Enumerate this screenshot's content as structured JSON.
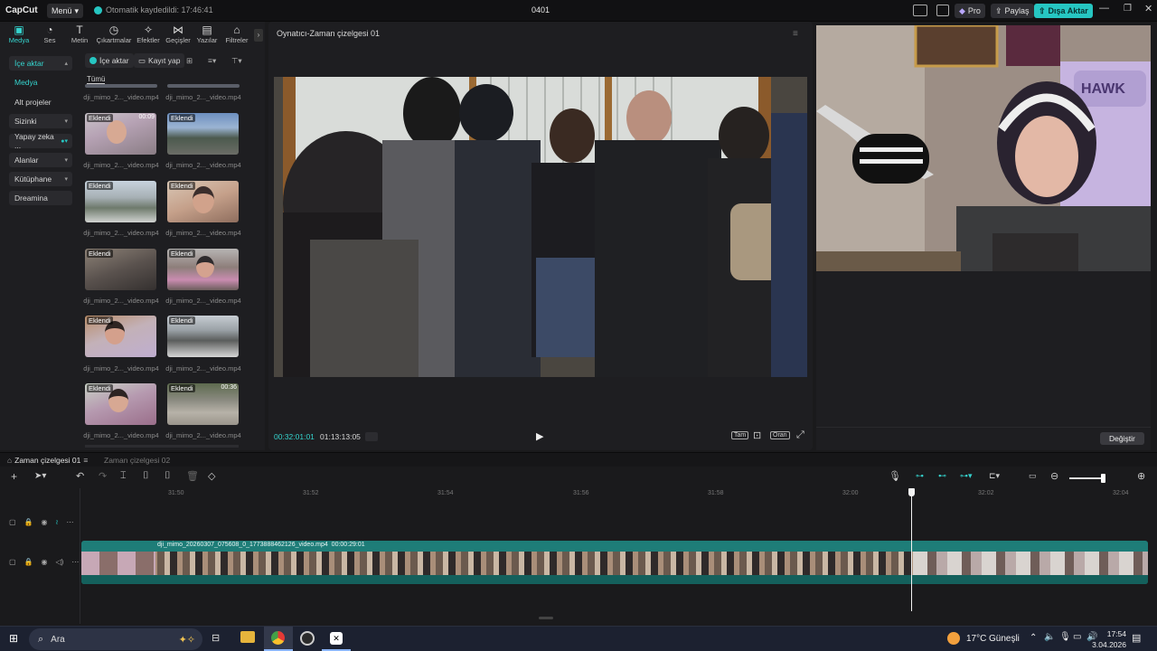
{
  "titlebar": {
    "logo": "CapCut",
    "menu": "Menü",
    "autosave": "Otomatik kaydedildi: 17:46:41",
    "project": "0401",
    "pro": "Pro",
    "share": "Paylaş",
    "export": "Dışa Aktar"
  },
  "tool_tabs": [
    "Medya",
    "Ses",
    "Metin",
    "Çıkartmalar",
    "Efektler",
    "Geçişler",
    "Yazılar",
    "Filtreler"
  ],
  "left_nav": [
    "İçe aktar",
    "Medya",
    "Alt projeler",
    "Sizinki",
    "Yapay zeka ...",
    "Alanlar",
    "Kütüphane",
    "Dreamina"
  ],
  "media_bar": {
    "import": "İçe aktar",
    "record": "Kayıt yap",
    "all": "Tümü"
  },
  "media_items": [
    {
      "label": "Eklendi",
      "duration": "00:09",
      "name": "dji_mimo_2..._video.mp4"
    },
    {
      "label": "Eklendi",
      "duration": "",
      "name": "dji_mimo_2..._video.mp4"
    },
    {
      "label": "Eklendi",
      "duration": "",
      "name": "dji_mimo_2..._video.mp4"
    },
    {
      "label": "Eklendi",
      "duration": "",
      "name": "dji_mimo_2..._video.mp4"
    },
    {
      "label": "Eklendi",
      "duration": "",
      "name": "dji_mimo_2..._video.mp4"
    },
    {
      "label": "Eklendi",
      "duration": "",
      "name": "dji_mimo_2..._video.mp4"
    },
    {
      "label": "Eklendi",
      "duration": "",
      "name": "dji_mimo_2..._video.mp4"
    },
    {
      "label": "Eklendi",
      "duration": "",
      "name": "dji_mimo_2..._video.mp4"
    },
    {
      "label": "Eklendi",
      "duration": "",
      "name": "dji_mimo_2..._video.mp4"
    },
    {
      "label": "Eklendi",
      "duration": "00:36",
      "name": "dji_mimo_2..._video.mp4"
    }
  ],
  "media_top_names": [
    "dji_mimo_2..._video.mp4",
    "dji_mimo_2..._video.mp4"
  ],
  "player": {
    "title": "Oynatıcı-Zaman çizelgesi 01",
    "current": "00:32:01:01",
    "total": "01:13:13:05",
    "full_label": "Tam",
    "ratio_label": "Oran"
  },
  "right_panel": {
    "change": "Değiştir"
  },
  "timeline": {
    "tab1": "Zaman çizelgesi 01",
    "tab2": "Zaman çizelgesi 02",
    "ticks": [
      "31:50",
      "31:52",
      "31:54",
      "31:56",
      "31:58",
      "32:00",
      "32:02",
      "32:04"
    ],
    "clip_name": "dji_mimo_20260307_075608_0_1773888462126_video.mp4",
    "clip_duration": "00:00:29:01"
  },
  "taskbar": {
    "search": "Ara",
    "weather": "17°C",
    "weather_desc": "Güneşli",
    "time": "17:54",
    "date": "3.04.2026"
  },
  "colors": {
    "accent": "#26c6c2",
    "clip": "#1e7d78"
  }
}
